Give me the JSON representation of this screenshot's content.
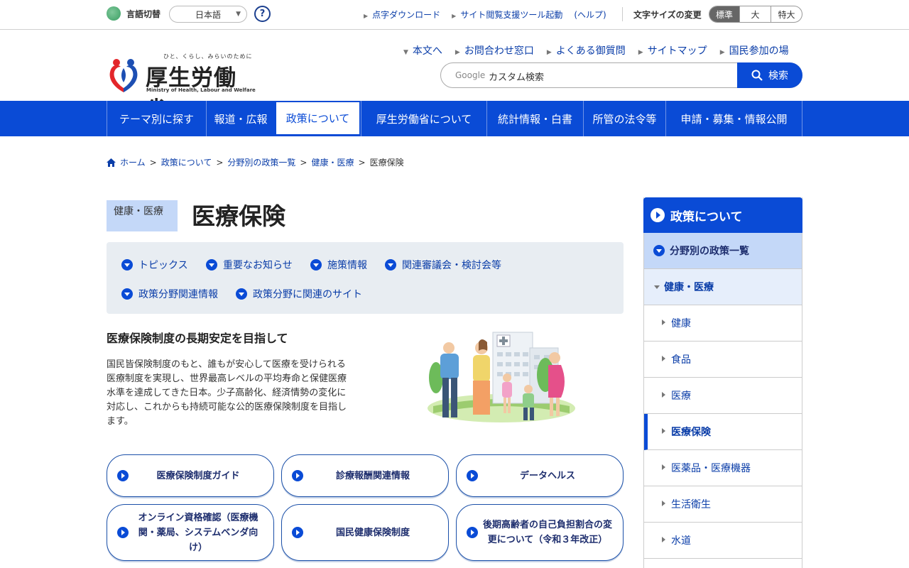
{
  "utility": {
    "lang_label": "言語切替",
    "lang_value": "日本語",
    "help_label": "?",
    "links": [
      "点字ダウンロード",
      "サイト閲覧支援ツール起動",
      "(ヘルプ)"
    ],
    "fontsize_label": "文字サイズの変更",
    "fontsize_options": [
      "標準",
      "大",
      "特大"
    ]
  },
  "logo": {
    "tagline": "ひと、くらし、みらいのために",
    "name": "厚生労働省",
    "english": "Ministry of Health, Labour and Welfare"
  },
  "header_links": [
    "本文へ",
    "お問合わせ窓口",
    "よくある御質問",
    "サイトマップ",
    "国民参加の場"
  ],
  "search": {
    "brand": "Google",
    "placeholder": "カスタム検索",
    "button": "検索"
  },
  "global_nav": [
    "テーマ別に探す",
    "報道・広報",
    "政策について",
    "厚生労働省について",
    "統計情報・白書",
    "所管の法令等",
    "申請・募集・情報公開"
  ],
  "breadcrumb": [
    "ホーム",
    "政策について",
    "分野別の政策一覧",
    "健康・医療",
    "医療保険"
  ],
  "page": {
    "category": "健康・医療",
    "title": "医療保険",
    "anchors": [
      "トピックス",
      "重要なお知らせ",
      "施策情報",
      "関連審議会・検討会等",
      "政策分野関連情報",
      "政策分野に関連のサイト"
    ],
    "intro_heading": "医療保険制度の長期安定を目指して",
    "intro_text": "国民皆保険制度のもと、誰もが安心して医療を受けられる医療制度を実現し、世界最高レベルの平均寿命と保健医療水準を達成してきた日本。少子高齢化、経済情勢の変化に対応し、これからも持続可能な公的医療保険制度を目指します。"
  },
  "cards": [
    "医療保険制度ガイド",
    "診療報酬関連情報",
    "データヘルス",
    "オンライン資格確認（医療機関・薬局、システムベンダ向け）",
    "国民健康保険制度",
    "後期高齢者の自己負担割合の変更について（令和３年改正）"
  ],
  "side_nav": {
    "head": "政策について",
    "level2": "分野別の政策一覧",
    "level3": "健康・医療",
    "items": [
      "健康",
      "食品",
      "医療",
      "医療保険",
      "医薬品・医療機器",
      "生活衛生",
      "水道"
    ]
  },
  "colors": {
    "primary": "#0a4bd6",
    "link": "#0a3da8",
    "accent_light": "#c4d8f8"
  }
}
